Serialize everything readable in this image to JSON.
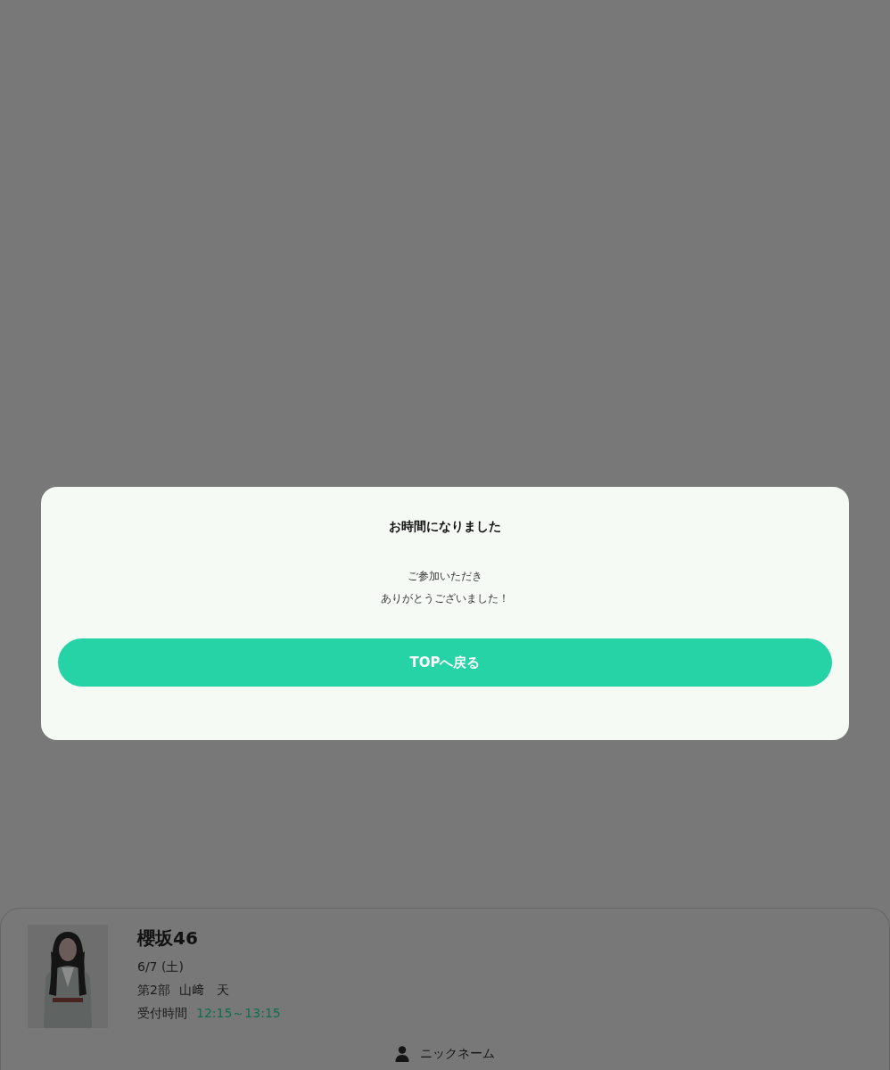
{
  "modal": {
    "title": "お時間になりました",
    "message": [
      "ご参加いただき",
      "ありがとうございました！"
    ],
    "button": "TOPへ戻る"
  },
  "ticket": {
    "group": "櫻坂46",
    "date": "6/7 (土)",
    "session": "第2部",
    "member": "山﨑　天",
    "reception_label": "受付時間",
    "reception_time": "12:15～13:15",
    "nickname_label": "ニックネーム"
  }
}
